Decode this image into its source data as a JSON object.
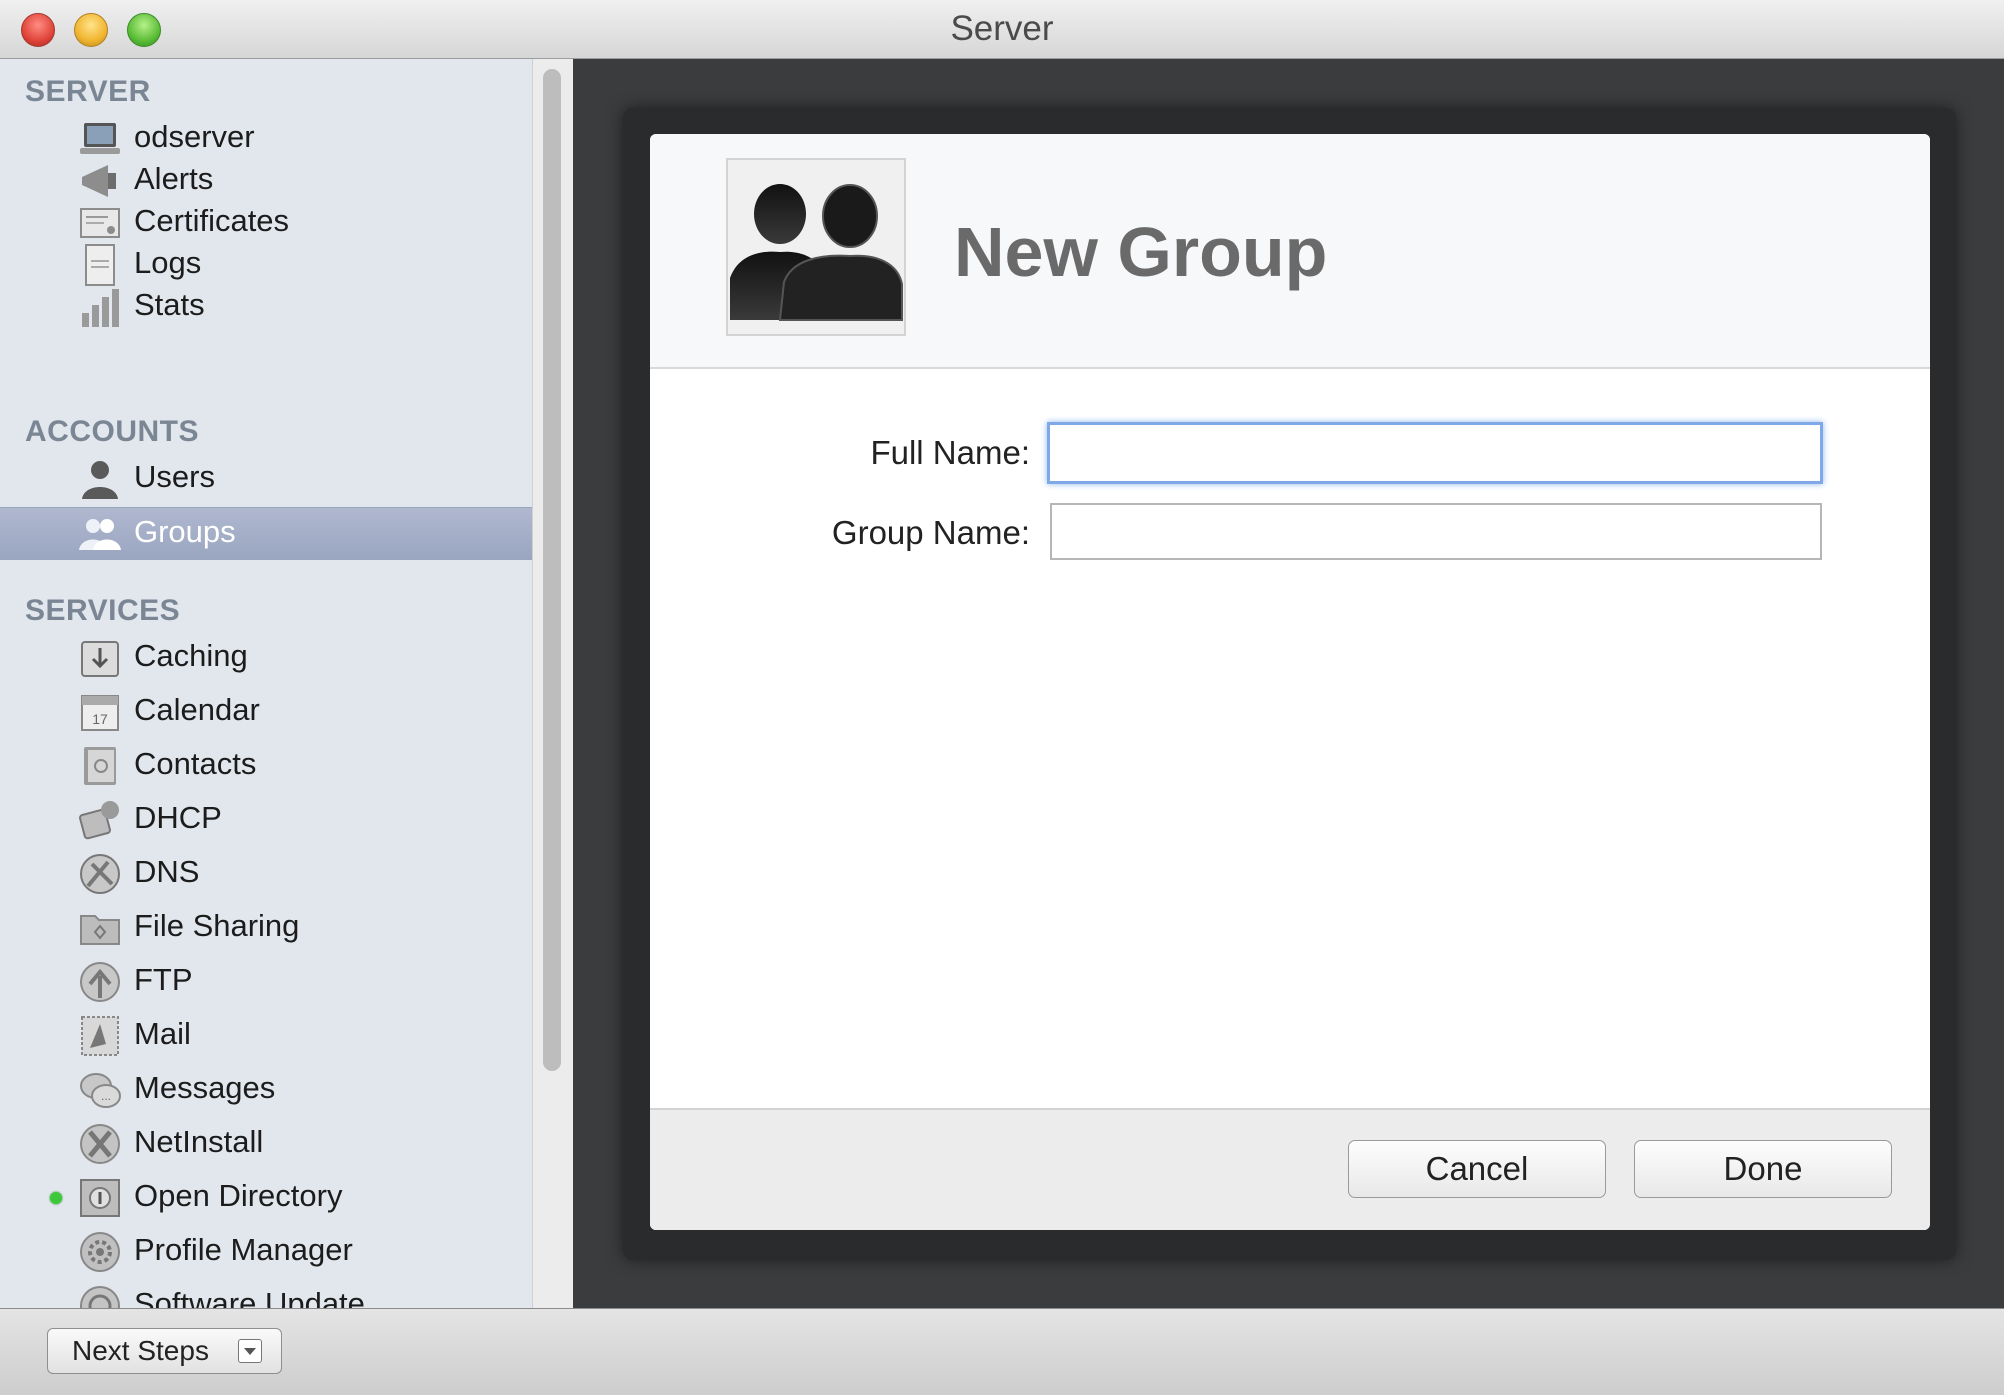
{
  "window": {
    "title": "Server"
  },
  "sidebar": {
    "sections": {
      "server": {
        "header": "SERVER",
        "items": [
          "odserver",
          "Alerts",
          "Certificates",
          "Logs",
          "Stats"
        ]
      },
      "accounts": {
        "header": "ACCOUNTS",
        "items": [
          "Users",
          "Groups"
        ]
      },
      "services": {
        "header": "SERVICES",
        "items": [
          "Caching",
          "Calendar",
          "Contacts",
          "DHCP",
          "DNS",
          "File Sharing",
          "FTP",
          "Mail",
          "Messages",
          "NetInstall",
          "Open Directory",
          "Profile Manager",
          "Software Update"
        ]
      }
    },
    "selected": "Groups",
    "status_running": "Open Directory"
  },
  "dialog": {
    "title": "New Group",
    "full_name_label": "Full Name:",
    "full_name_value": "",
    "group_name_label": "Group Name:",
    "group_name_value": "",
    "cancel_label": "Cancel",
    "done_label": "Done"
  },
  "footer": {
    "next_steps_label": "Next Steps"
  },
  "colors": {
    "selection": "#9aa5c0",
    "focus_ring": "#7fa9e6",
    "status_green": "#3cc83a"
  }
}
